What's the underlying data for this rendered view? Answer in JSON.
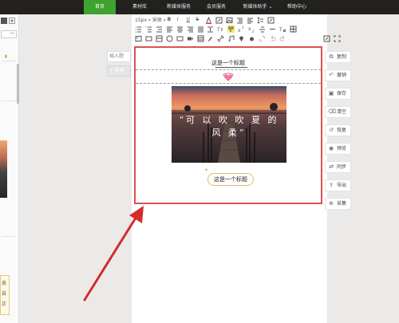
{
  "nav": {
    "items": [
      {
        "label": "首页",
        "active": true
      },
      {
        "label": "素材库"
      },
      {
        "label": "新媒体服务"
      },
      {
        "label": "会员服务"
      },
      {
        "label": "新媒体助手 ⌄"
      },
      {
        "label": "帮助中心"
      }
    ]
  },
  "left": {
    "insert_label": "插入题",
    "new_label": "+ 新建",
    "snippet_lines": [
      "息",
      "自",
      "正"
    ]
  },
  "toolbar": {
    "font_size": "15px",
    "font_name": "宋体"
  },
  "editor": {
    "title_top": "这是一个标题",
    "photo_caption": "“可 以 吹 吹 夏 的 风 柔”",
    "title_bottom": "这是一个标题"
  },
  "right_panel": {
    "items": [
      {
        "icon": "copy-icon",
        "glyph": "⧉",
        "label": "复制"
      },
      {
        "icon": "undo-icon",
        "glyph": "↶",
        "label": "撤销"
      },
      {
        "icon": "save-icon",
        "glyph": "▣",
        "label": "保存"
      },
      {
        "icon": "clear-icon",
        "glyph": "⌫",
        "label": "清空"
      },
      {
        "icon": "restore-icon",
        "glyph": "↺",
        "label": "恢复"
      },
      {
        "icon": "preview-icon",
        "glyph": "◉",
        "label": "预览"
      },
      {
        "icon": "sync-icon",
        "glyph": "⇄",
        "label": "同步"
      },
      {
        "icon": "export-icon",
        "glyph": "⇪",
        "label": "导出"
      },
      {
        "icon": "collect-icon",
        "glyph": "⊕",
        "label": "采集"
      }
    ]
  },
  "colors": {
    "nav_bg": "#23211f",
    "nav_active": "#3ea32e",
    "canvas_border": "#d9534f",
    "arrow": "#d42b2b"
  }
}
